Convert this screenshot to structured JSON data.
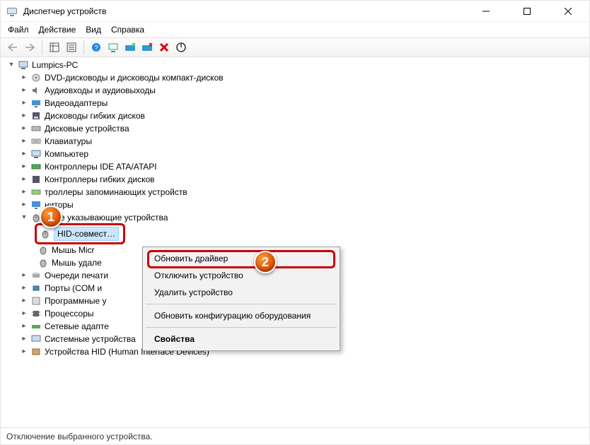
{
  "window": {
    "title": "Диспетчер устройств"
  },
  "menu": {
    "file": "Файл",
    "action": "Действие",
    "view": "Вид",
    "help": "Справка"
  },
  "tree": {
    "root": "Lumpics-PC",
    "nodes": {
      "dvd": "DVD-дисководы и дисководы компакт-дисков",
      "audio": "Аудиовходы и аудиовыходы",
      "video": "Видеоадаптеры",
      "floppy_drives": "Дисководы гибких дисков",
      "disk_devices": "Дисковые устройства",
      "keyboards": "Клавиатуры",
      "computer": "Компьютер",
      "ide": "Контроллеры IDE ATA/ATAPI",
      "floppy_ctrl": "Контроллеры гибких дисков",
      "storage_ctrl": "троллеры запоминающих устройств",
      "monitors": "ниторы",
      "mice_category": "иные указывающие устройства",
      "hid_mouse": "HID-совмест…",
      "ms_mouse": "Мышь Micr",
      "rm_mouse": "Мышь удале",
      "print_queues": "Очереди печати",
      "ports": "Порты (COM и",
      "software": "Программные у",
      "cpus": "Процессоры",
      "net": "Сетевые адапте",
      "system": "Системные устройства",
      "hid_devices": "Устройства HID (Human Interface Devices)"
    }
  },
  "context_menu": {
    "update_driver": "Обновить драйвер",
    "disable": "Отключить устройство",
    "uninstall": "Удалить устройство",
    "scan": "Обновить конфигурацию оборудования",
    "properties": "Свойства"
  },
  "badges": {
    "one": "1",
    "two": "2"
  },
  "status": "Отключение выбранного устройства."
}
